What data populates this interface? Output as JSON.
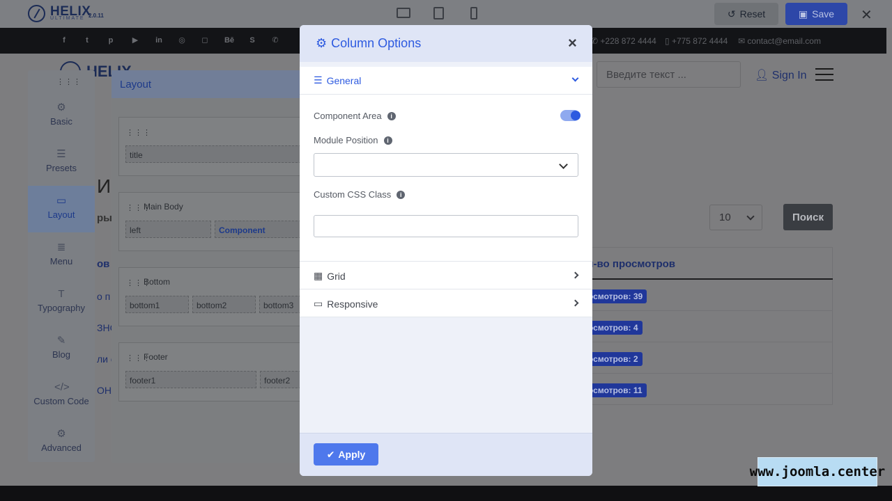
{
  "topbar": {
    "logo_name": "HELIX",
    "logo_sub": "ULTIMATE",
    "version": "2.0.11",
    "reset_label": "Reset",
    "save_label": "Save"
  },
  "site": {
    "contact_phone1": "+228 872 4444",
    "contact_phone2": "+775 872 4444",
    "contact_email": "contact@email.com",
    "logo_text": "HELIX",
    "search_placeholder": "Введите текст ...",
    "sign_in_label": "Sign In",
    "per_page_value": "10",
    "search_button": "Поиск",
    "table_header": "л-во просмотров",
    "badges": [
      "осмотров: 39",
      "осмотров: 4",
      "осмотров: 2",
      "осмотров: 11"
    ],
    "heading_fragment": "И",
    "subheading_fragment": "ры",
    "col_fragment": "ов",
    "row_fragments": [
      "о п",
      "ЗНО",
      "ли с",
      "ОН"
    ],
    "watermark": "www.joomla.center"
  },
  "sidebar": {
    "items": [
      {
        "label": "Basic",
        "icon": "gear-icon"
      },
      {
        "label": "Presets",
        "icon": "sliders-icon"
      },
      {
        "label": "Layout",
        "icon": "layout-icon"
      },
      {
        "label": "Menu",
        "icon": "menu-list-icon"
      },
      {
        "label": "Typography",
        "icon": "typography-icon"
      },
      {
        "label": "Blog",
        "icon": "blog-icon"
      },
      {
        "label": "Custom Code",
        "icon": "code-icon"
      },
      {
        "label": "Advanced",
        "icon": "advanced-icon"
      }
    ]
  },
  "layout_panel": {
    "title": "Layout",
    "rows": [
      {
        "label": "",
        "columns": [
          "title"
        ]
      },
      {
        "label": "Main Body",
        "columns": [
          "left",
          "Component"
        ]
      },
      {
        "label": "Bottom",
        "columns": [
          "bottom1",
          "bottom2",
          "bottom3"
        ]
      },
      {
        "label": "Footer",
        "columns": [
          "footer1",
          "footer2"
        ]
      }
    ]
  },
  "modal": {
    "title": "Column Options",
    "general_label": "General",
    "component_area_label": "Component Area",
    "component_area_enabled": true,
    "module_position_label": "Module Position",
    "module_position_value": "",
    "custom_css_label": "Custom CSS Class",
    "custom_css_value": "",
    "grid_label": "Grid",
    "responsive_label": "Responsive",
    "apply_label": "Apply"
  }
}
